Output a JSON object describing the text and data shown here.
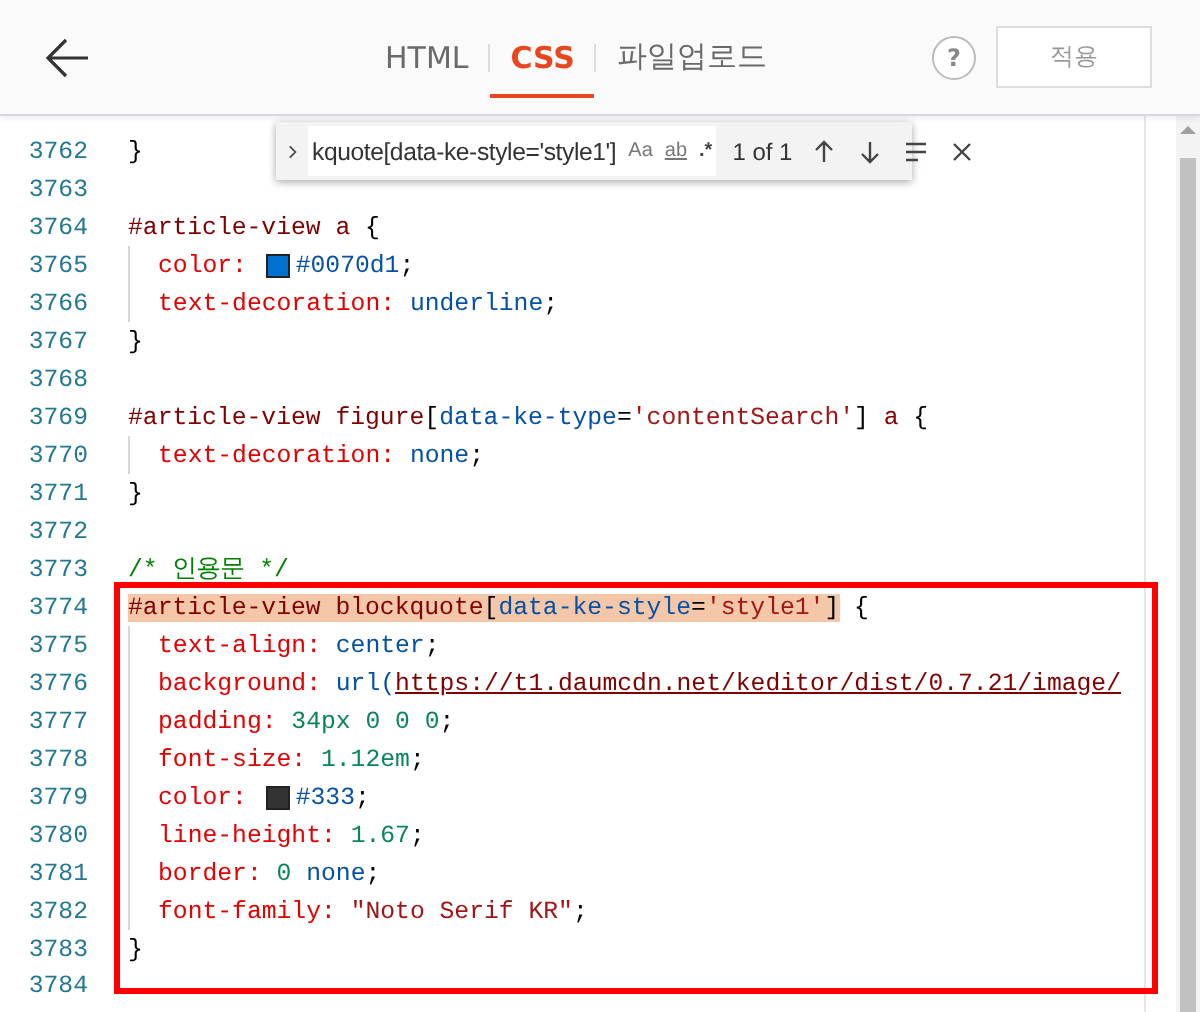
{
  "header": {
    "tabs": [
      {
        "label": "HTML",
        "selected": false
      },
      {
        "label": "CSS",
        "selected": true
      },
      {
        "label": "파일업로드",
        "selected": false
      }
    ],
    "help": "?",
    "apply_button": "적용"
  },
  "find": {
    "query": "kquote[data-ke-style='style1']",
    "options": [
      "Aa",
      "ab",
      ".*"
    ],
    "result": "1 of 1"
  },
  "blocks": [
    {
      "kind": "plain",
      "lines": [
        {
          "number": "3762",
          "tokens": [
            {
              "kind": "punct",
              "text": "}"
            }
          ]
        },
        {
          "number": "3763"
        },
        {
          "number": "3764",
          "tokens": [
            {
              "kind": "sel",
              "text": "#article-view a "
            },
            {
              "kind": "punct",
              "text": "{"
            }
          ]
        },
        {
          "number": "3765",
          "indent": true,
          "tokens": [
            {
              "kind": "prop",
              "text": "color: "
            },
            {
              "kind": "swatch",
              "color": "#0070d1"
            },
            {
              "kind": "val",
              "text": "#0070d1"
            },
            {
              "kind": "punct",
              "text": ";"
            }
          ]
        },
        {
          "number": "3766",
          "indent": true,
          "tokens": [
            {
              "kind": "prop",
              "text": "text-decoration: "
            },
            {
              "kind": "val",
              "text": "underline"
            },
            {
              "kind": "punct",
              "text": ";"
            }
          ]
        },
        {
          "number": "3767",
          "tokens": [
            {
              "kind": "punct",
              "text": "}"
            }
          ]
        },
        {
          "number": "3768"
        },
        {
          "number": "3769",
          "tokens": [
            {
              "kind": "sel",
              "text": "#article-view figure"
            },
            {
              "kind": "punct",
              "text": "["
            },
            {
              "kind": "attr",
              "text": "data-ke-type"
            },
            {
              "kind": "punct",
              "text": "="
            },
            {
              "kind": "str",
              "text": "'contentSearch'"
            },
            {
              "kind": "punct",
              "text": "]"
            },
            {
              "kind": "sel",
              "text": " a "
            },
            {
              "kind": "punct",
              "text": "{"
            }
          ]
        },
        {
          "number": "3770",
          "indent": true,
          "tokens": [
            {
              "kind": "prop",
              "text": "text-decoration: "
            },
            {
              "kind": "val",
              "text": "none"
            },
            {
              "kind": "punct",
              "text": ";"
            }
          ]
        },
        {
          "number": "3771",
          "tokens": [
            {
              "kind": "punct",
              "text": "}"
            }
          ]
        },
        {
          "number": "3772"
        },
        {
          "number": "3773",
          "tokens": [
            {
              "kind": "com",
              "text": "/* 인용문 */"
            }
          ]
        }
      ]
    },
    {
      "kind": "framed",
      "lines": [
        {
          "number": "3774",
          "match": [
            {
              "kind": "sel",
              "text": "#article-view blockquote"
            },
            {
              "kind": "punct",
              "text": "["
            },
            {
              "kind": "attr",
              "text": "data-ke-style"
            },
            {
              "kind": "punct",
              "text": "="
            },
            {
              "kind": "str",
              "text": "'style1'"
            },
            {
              "kind": "punct",
              "text": "]"
            }
          ],
          "tokens": [
            {
              "kind": "punct",
              "text": " {"
            }
          ]
        },
        {
          "number": "3775",
          "indent": true,
          "tokens": [
            {
              "kind": "prop",
              "text": "text-align: "
            },
            {
              "kind": "val",
              "text": "center"
            },
            {
              "kind": "punct",
              "text": ";"
            }
          ]
        },
        {
          "number": "3776",
          "indent": true,
          "tokens": [
            {
              "kind": "prop",
              "text": "background: "
            },
            {
              "kind": "val",
              "text": "url("
            },
            {
              "kind": "url",
              "text": "https://t1.daumcdn.net/keditor/dist/0.7.21/image/"
            }
          ]
        },
        {
          "number": "3777",
          "indent": true,
          "tokens": [
            {
              "kind": "prop",
              "text": "padding: "
            },
            {
              "kind": "num",
              "text": "34px 0 0 0"
            },
            {
              "kind": "punct",
              "text": ";"
            }
          ]
        },
        {
          "number": "3778",
          "indent": true,
          "tokens": [
            {
              "kind": "prop",
              "text": "font-size: "
            },
            {
              "kind": "num",
              "text": "1.12em"
            },
            {
              "kind": "punct",
              "text": ";"
            }
          ]
        },
        {
          "number": "3779",
          "indent": true,
          "tokens": [
            {
              "kind": "prop",
              "text": "color: "
            },
            {
              "kind": "swatch",
              "color": "#333333"
            },
            {
              "kind": "val",
              "text": "#333"
            },
            {
              "kind": "punct",
              "text": ";"
            }
          ]
        },
        {
          "number": "3780",
          "indent": true,
          "tokens": [
            {
              "kind": "prop",
              "text": "line-height: "
            },
            {
              "kind": "num",
              "text": "1.67"
            },
            {
              "kind": "punct",
              "text": ";"
            }
          ]
        },
        {
          "number": "3781",
          "indent": true,
          "tokens": [
            {
              "kind": "prop",
              "text": "border: "
            },
            {
              "kind": "num",
              "text": "0 "
            },
            {
              "kind": "val",
              "text": "none"
            },
            {
              "kind": "punct",
              "text": ";"
            }
          ]
        },
        {
          "number": "3782",
          "indent": true,
          "tokens": [
            {
              "kind": "prop",
              "text": "font-family: "
            },
            {
              "kind": "str",
              "text": "\"Noto Serif KR\""
            },
            {
              "kind": "punct",
              "text": ";"
            }
          ]
        },
        {
          "number": "3783",
          "tokens": [
            {
              "kind": "punct",
              "text": "}"
            }
          ]
        }
      ]
    },
    {
      "kind": "plain",
      "lines": [
        {
          "number": "3784"
        }
      ]
    }
  ]
}
